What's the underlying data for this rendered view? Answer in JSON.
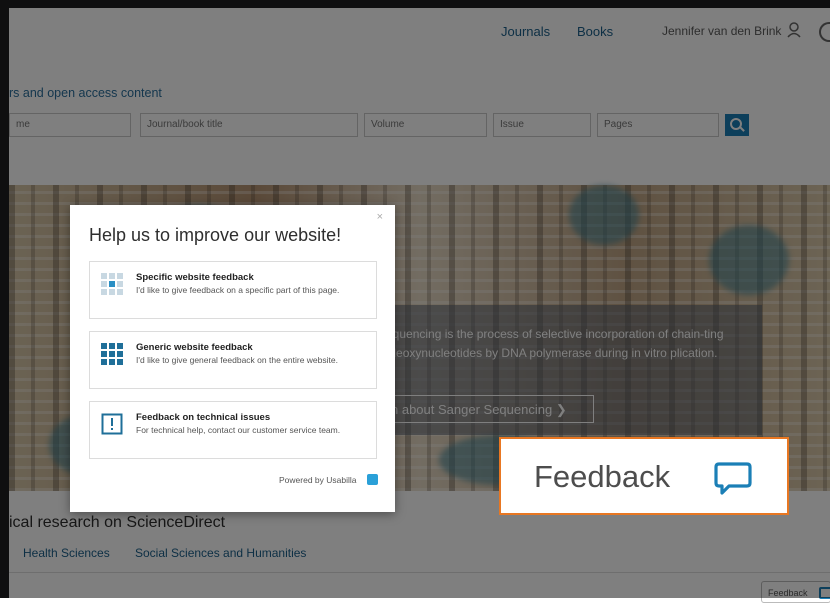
{
  "header": {
    "nav": [
      "Journals",
      "Books"
    ],
    "user_name": "Jennifer van den Brink"
  },
  "search": {
    "title": "rs and open access content",
    "fields": [
      {
        "placeholder": "me"
      },
      {
        "placeholder": "Journal/book title"
      },
      {
        "placeholder": "Volume"
      },
      {
        "placeholder": "Issue"
      },
      {
        "placeholder": "Pages"
      }
    ]
  },
  "hero": {
    "text": "sequencing is the process of selective incorporation of chain-ting dideoxynucleotides by DNA polymerase during in vitro plication.",
    "link_label": "n about Sanger Sequencing"
  },
  "section": {
    "title": "ical research on ScienceDirect",
    "tabs": [
      "Health Sciences",
      "Social Sciences and Humanities"
    ]
  },
  "small_feedback_label": "Feedback",
  "modal": {
    "close": "×",
    "title": "Help us to improve our website!",
    "options": [
      {
        "title": "Specific website feedback",
        "desc": "I'd like to give feedback on a specific part of this page.",
        "icon": "specific-grid-icon"
      },
      {
        "title": "Generic website feedback",
        "desc": "I'd like to give general feedback on the entire website.",
        "icon": "generic-grid-icon"
      },
      {
        "title": "Feedback on technical issues",
        "desc": "For technical help, contact our customer service team.",
        "icon": "exclamation-icon"
      }
    ],
    "powered_by": "Powered by Usabilla"
  },
  "feedback_tab": {
    "label": "Feedback"
  },
  "colors": {
    "accent": "#1b7fb6",
    "feedback_border": "#e87722"
  }
}
